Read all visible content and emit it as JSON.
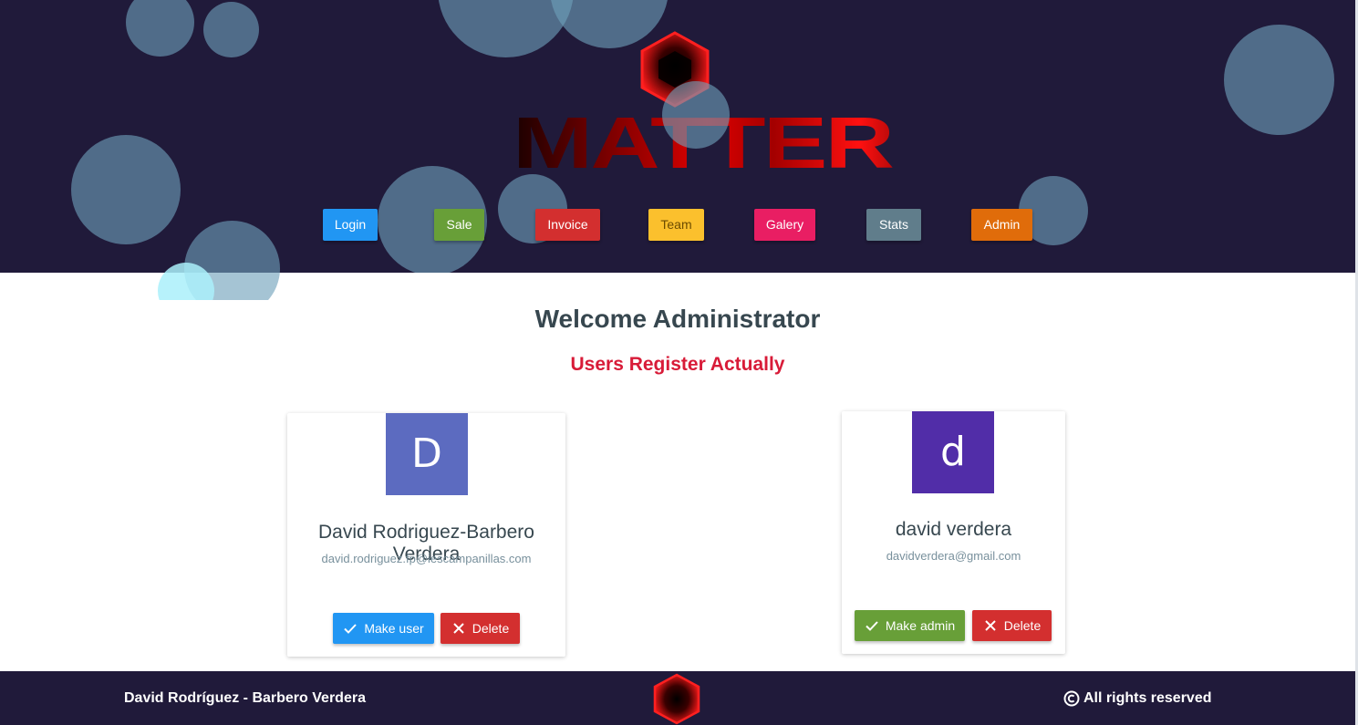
{
  "brand": {
    "logo_text": "MATTER",
    "logo_icon": "red-hexagon-cube-icon",
    "colors": {
      "header_bg": "#201a3a",
      "logo_red": "#e00000",
      "subtitle": "#d81b38"
    }
  },
  "nav": {
    "items": [
      {
        "label": "Login",
        "color": "#2196f3"
      },
      {
        "label": "Sale",
        "color": "#689f38"
      },
      {
        "label": "Invoice",
        "color": "#d32f2f"
      },
      {
        "label": "Team",
        "color": "#fbc02d"
      },
      {
        "label": "Galery",
        "color": "#e91e63"
      },
      {
        "label": "Stats",
        "color": "#607d8b"
      },
      {
        "label": "Admin",
        "color": "#e06c0a"
      }
    ]
  },
  "main": {
    "welcome": "Welcome Administrator",
    "subtitle": "Users Register Actually"
  },
  "users": [
    {
      "avatar_letter": "D",
      "avatar_color": "#5c6bc0",
      "name": "David Rodriguez-Barbero Verdera",
      "email": "david.rodriguez.fp@iescampanillas.com",
      "role_action": {
        "label": "Make user",
        "icon": "check-icon",
        "color": "#2196f3"
      },
      "delete_action": {
        "label": "Delete",
        "icon": "close-icon",
        "color": "#d32f2f"
      }
    },
    {
      "avatar_letter": "d",
      "avatar_color": "#512da8",
      "name": "david verdera",
      "email": "davidverdera@gmail.com",
      "role_action": {
        "label": "Make admin",
        "icon": "check-icon",
        "color": "#689f38"
      },
      "delete_action": {
        "label": "Delete",
        "icon": "close-icon",
        "color": "#d32f2f"
      }
    }
  ],
  "footer": {
    "author": "David Rodríguez - Barbero Verdera",
    "rights": "All rights reserved",
    "rights_icon": "copyright-icon"
  }
}
